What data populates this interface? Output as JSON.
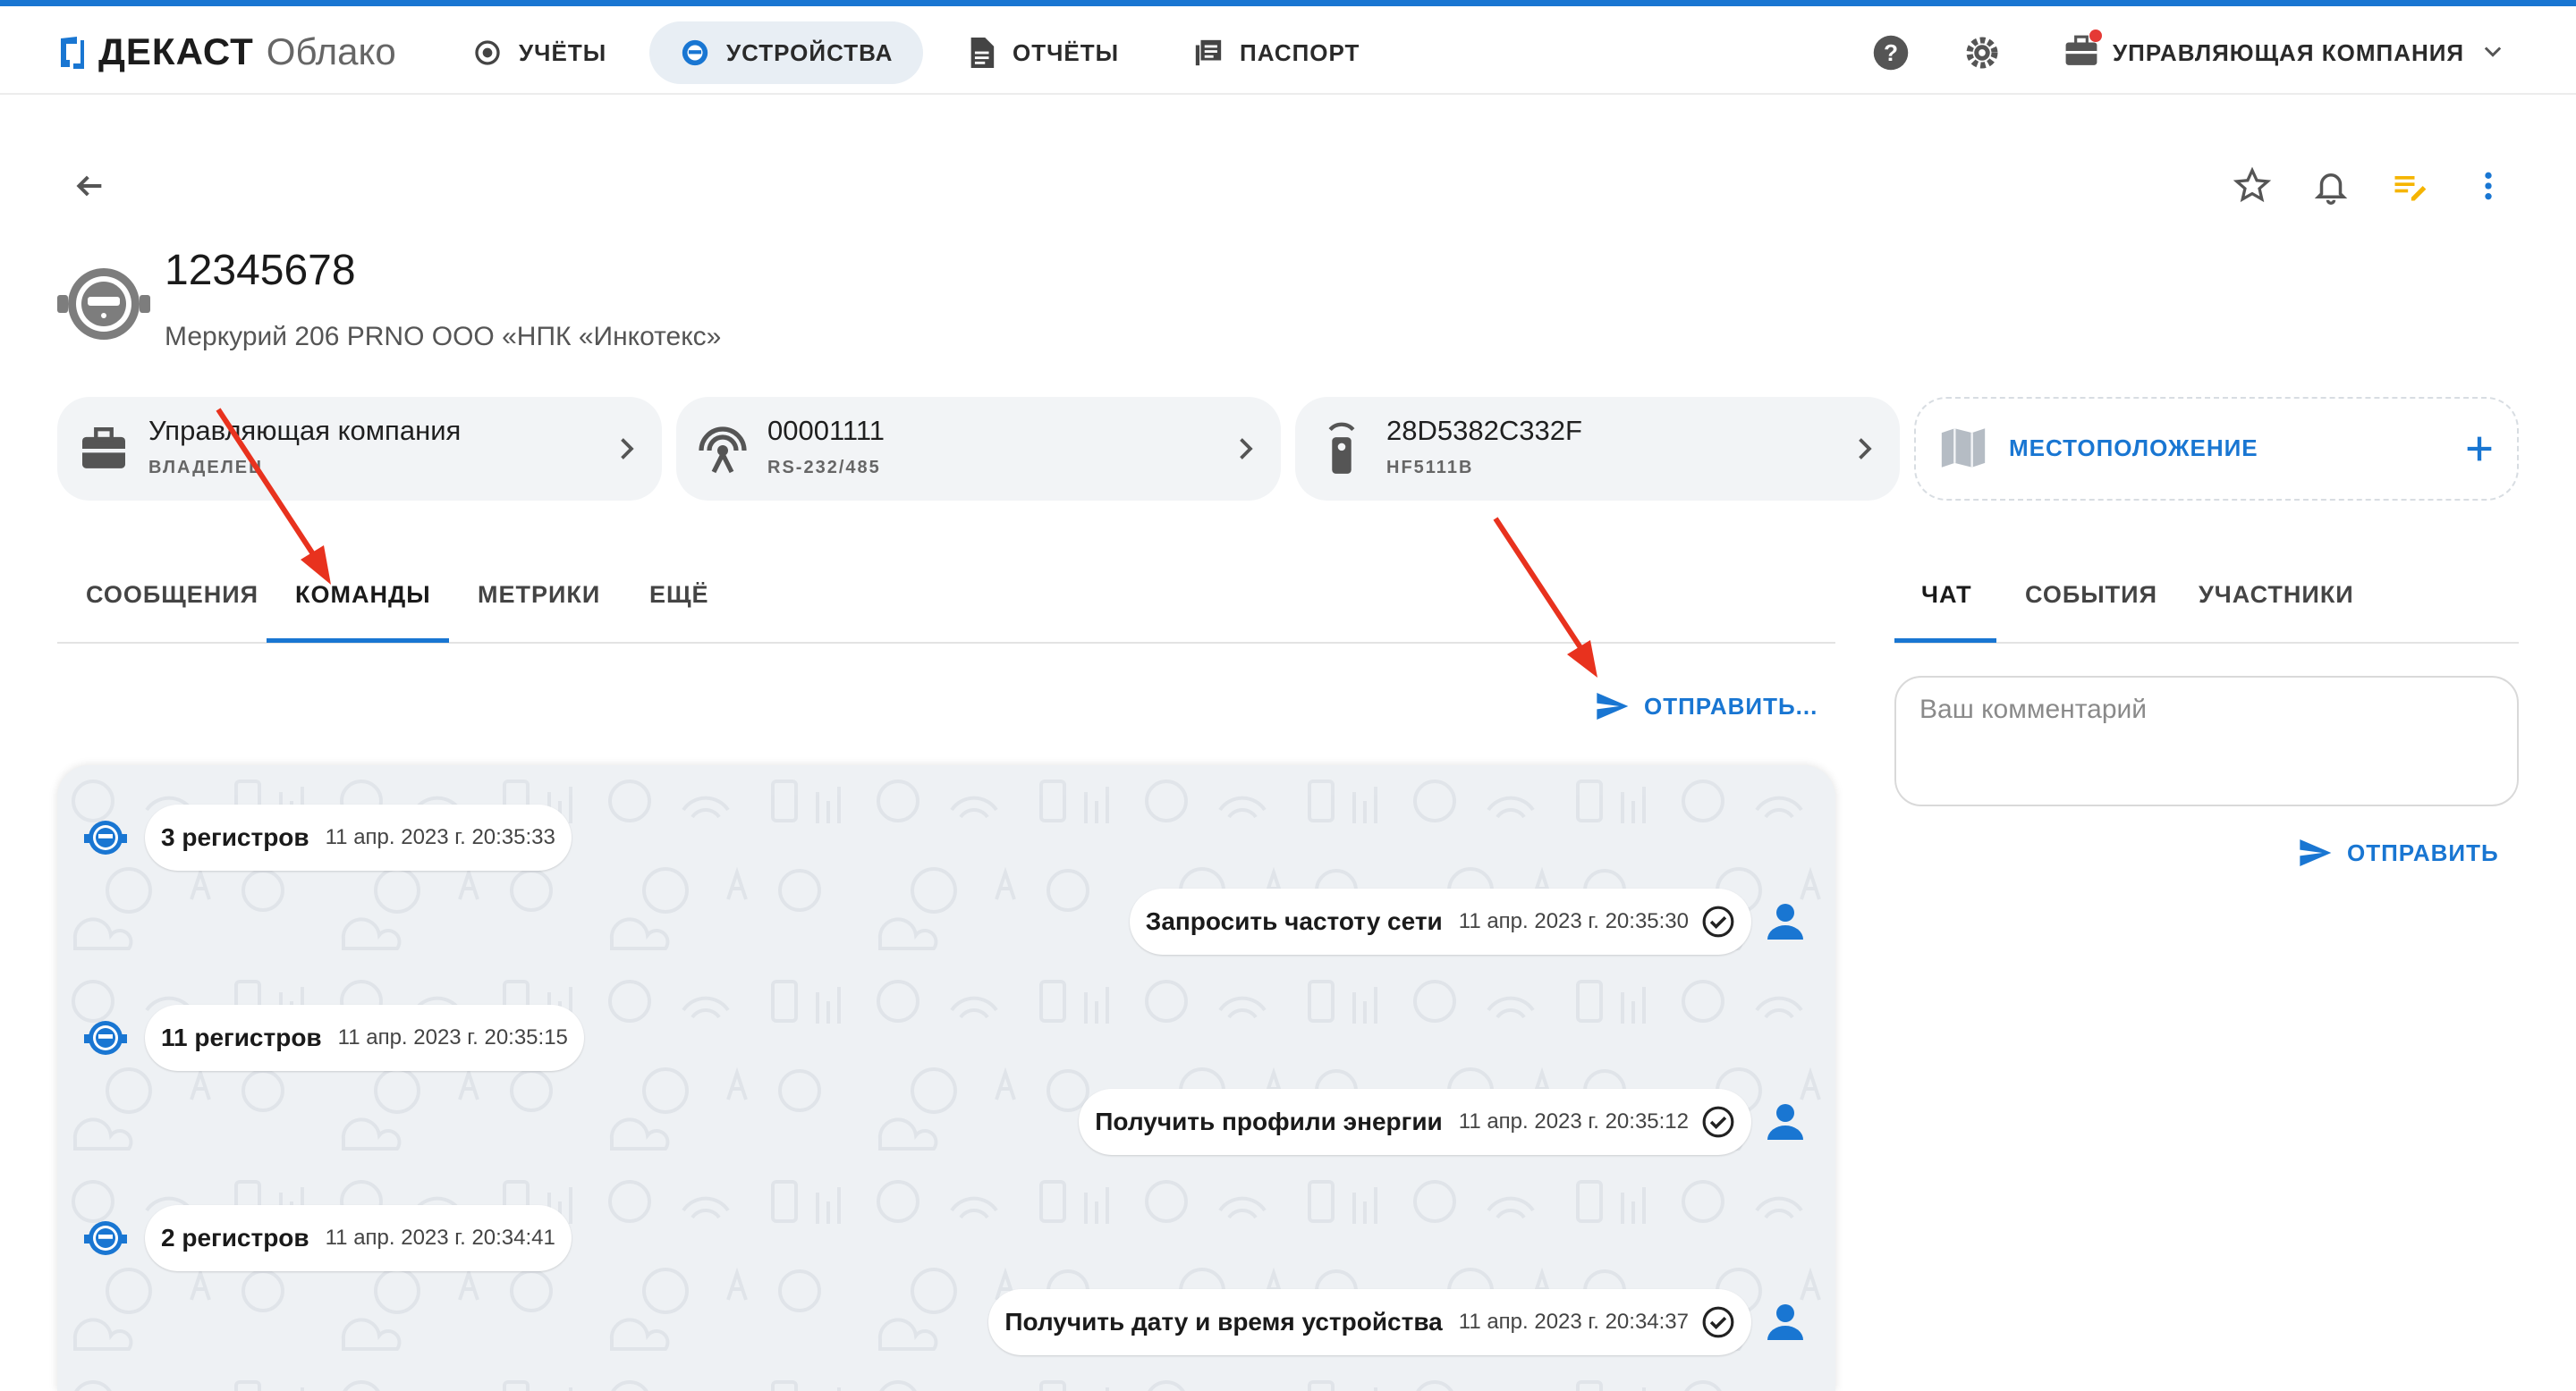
{
  "app": {
    "brand": "ДЕКАСТ",
    "brand_sub": "Облако",
    "accent": "#1976d2"
  },
  "nav": {
    "items": [
      {
        "label": "УЧЁТЫ",
        "icon": "cog-circle-icon"
      },
      {
        "label": "УСТРОЙСТВА",
        "icon": "meter-icon"
      },
      {
        "label": "ОТЧЁТЫ",
        "icon": "document-icon"
      },
      {
        "label": "ПАСПОРТ",
        "icon": "library-icon"
      }
    ],
    "active": "УСТРОЙСТВА",
    "company_label": "УПРАВЛЯЮЩАЯ КОМПАНИЯ"
  },
  "device": {
    "title": "12345678",
    "subtitle": "Меркурий 206 PRNO ООО «НПК «Инкотекс»"
  },
  "cards": [
    {
      "title": "Управляющая компания",
      "sub": "ВЛАДЕЛЕЦ",
      "icon": "briefcase-icon"
    },
    {
      "title": "00001111",
      "sub": "RS-232/485",
      "icon": "antenna-icon"
    },
    {
      "title": "28D5382C332F",
      "sub": "HF5111B",
      "icon": "remote-icon"
    }
  ],
  "location_card": {
    "label": "МЕСТОПОЛОЖЕНИЕ"
  },
  "tabs": {
    "main": [
      "СООБЩЕНИЯ",
      "КОМАНДЫ",
      "МЕТРИКИ",
      "ЕЩЁ"
    ],
    "main_active": "КОМАНДЫ",
    "side": [
      "ЧАТ",
      "СОБЫТИЯ",
      "УЧАСТНИКИ"
    ],
    "side_active": "ЧАТ"
  },
  "send_commands_label": "ОТПРАВИТЬ...",
  "messages": [
    {
      "text": "3 регистров",
      "time": "11 апр. 2023 г. 20:35:33",
      "side": "device"
    },
    {
      "text": "Запросить частоту сети",
      "time": "11 апр. 2023 г. 20:35:30",
      "side": "user"
    },
    {
      "text": "11 регистров",
      "time": "11 апр. 2023 г. 20:35:15",
      "side": "device"
    },
    {
      "text": "Получить профили энергии",
      "time": "11 апр. 2023 г. 20:35:12",
      "side": "user"
    },
    {
      "text": "2 регистров",
      "time": "11 апр. 2023 г. 20:34:41",
      "side": "device"
    },
    {
      "text": "Получить дату и время устройства",
      "time": "11 апр. 2023 г. 20:34:37",
      "side": "user"
    }
  ],
  "comment": {
    "placeholder": "Ваш комментарий",
    "send_label": "ОТПРАВИТЬ"
  }
}
